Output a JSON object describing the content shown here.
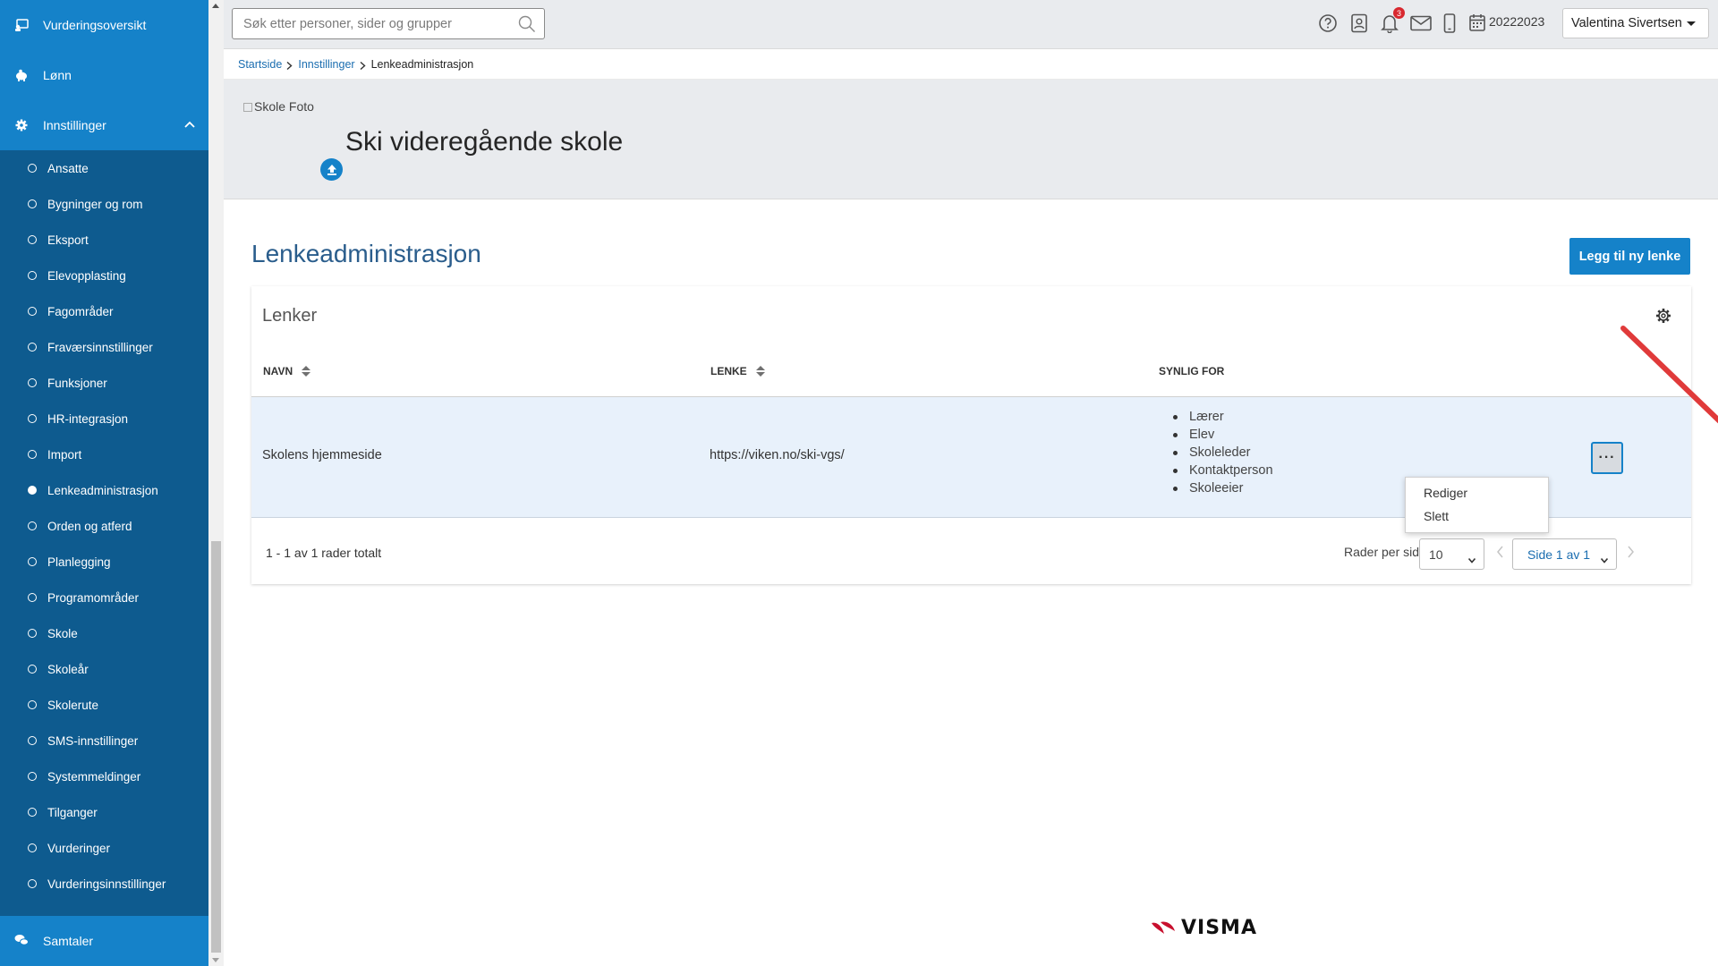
{
  "sidebar": {
    "top_items": [
      {
        "label": "Vurderingsoversikt",
        "icon": "assessment-overview-icon"
      },
      {
        "label": "Lønn",
        "icon": "piggy-bank-icon"
      }
    ],
    "settings": {
      "label": "Innstillinger",
      "icon": "gear-icon",
      "expanded": true
    },
    "sub_items": [
      {
        "label": "Ansatte"
      },
      {
        "label": "Bygninger og rom"
      },
      {
        "label": "Eksport"
      },
      {
        "label": "Elevopplasting"
      },
      {
        "label": "Fagområder"
      },
      {
        "label": "Fraværsinnstillinger"
      },
      {
        "label": "Funksjoner"
      },
      {
        "label": "HR-integrasjon"
      },
      {
        "label": "Import"
      },
      {
        "label": "Lenkeadministrasjon",
        "active": true
      },
      {
        "label": "Orden og atferd"
      },
      {
        "label": "Planlegging"
      },
      {
        "label": "Programområder"
      },
      {
        "label": "Skole"
      },
      {
        "label": "Skoleår"
      },
      {
        "label": "Skolerute"
      },
      {
        "label": "SMS-innstillinger"
      },
      {
        "label": "Systemmeldinger"
      },
      {
        "label": "Tilganger"
      },
      {
        "label": "Vurderinger"
      },
      {
        "label": "Vurderingsinnstillinger"
      }
    ],
    "bottom_item": {
      "label": "Samtaler",
      "icon": "chat-bubbles-icon"
    }
  },
  "topbar": {
    "search_placeholder": "Søk etter personer, sider og grupper",
    "notification_count": "3",
    "school_year": "20222023",
    "user_name": "Valentina Sivertsen"
  },
  "breadcrumb": {
    "items": [
      "Startside",
      "Innstillinger"
    ],
    "current": "Lenkeadministrasjon"
  },
  "banner": {
    "photo_alt": "Skole Foto",
    "school_name": "Ski videregående skole"
  },
  "page": {
    "title": "Lenkeadministrasjon",
    "add_button": "Legg til ny lenke"
  },
  "table": {
    "title": "Lenker",
    "columns": {
      "name": "NAVN",
      "link": "LENKE",
      "visible_for": "SYNLIG FOR"
    },
    "rows": [
      {
        "name": "Skolens hjemmeside",
        "link": "https://viken.no/ski-vgs/",
        "visible_for": [
          "Lærer",
          "Elev",
          "Skoleleder",
          "Kontaktperson",
          "Skoleeier"
        ]
      }
    ],
    "row_menu": {
      "more_label": "···",
      "items": [
        "Rediger",
        "Slett"
      ]
    },
    "totals": "1 - 1 av 1 rader totalt",
    "rows_per_page_label": "Rader per side",
    "rows_per_page": "10",
    "page_label": "Side 1 av 1"
  },
  "footer": {
    "logo_text": "VISMA"
  },
  "colors": {
    "sidebar_bg": "#0e5b8f",
    "sidebar_highlight": "#1582c9",
    "primary": "#1582c9",
    "title_blue": "#2a5d8c",
    "row_selected": "#e8f1fb",
    "badge_red": "#d8282f",
    "annotation_arrow": "#e03a3a",
    "logo_red": "#c8102e"
  }
}
